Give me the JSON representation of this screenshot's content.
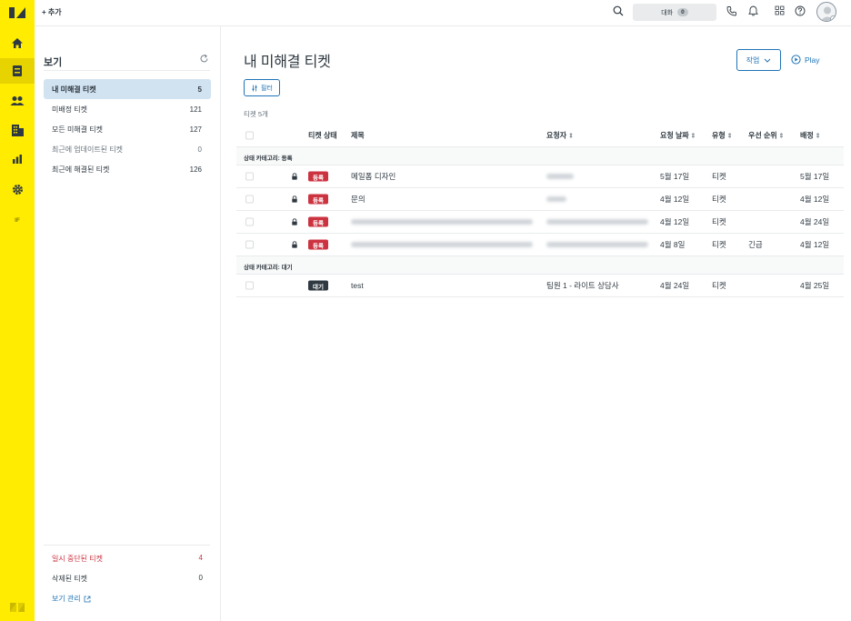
{
  "topbar": {
    "add_label": "+ 추가",
    "chat_label": "대화",
    "chat_count": "0"
  },
  "rail": {
    "items": [
      "home-icon",
      "tickets-icon",
      "users-icon",
      "organizations-icon",
      "reports-icon",
      "settings-icon"
    ],
    "extra_label": "IF"
  },
  "views": {
    "title": "보기",
    "items": [
      {
        "label": "내 미해결 티켓",
        "count": "5"
      },
      {
        "label": "미배정 티켓",
        "count": "121"
      },
      {
        "label": "모든 미해결 티켓",
        "count": "127"
      },
      {
        "label": "최근에 업데이트된 티켓",
        "count": "0"
      },
      {
        "label": "최근에 해결된 티켓",
        "count": "126"
      }
    ],
    "suspended": {
      "label": "일시 중단된 티켓",
      "count": "4"
    },
    "deleted": {
      "label": "삭제된 티켓",
      "count": "0"
    },
    "manage_label": "보기 관리"
  },
  "main": {
    "title": "내 미해결 티켓",
    "action_label": "작업",
    "play_label": "Play",
    "filter_label": "필터",
    "count_label": "티켓 5개",
    "columns": {
      "status": "티켓 상태",
      "subject": "제목",
      "requester": "요청자",
      "requested": "요청 날짜",
      "type": "유형",
      "priority": "우선 순위",
      "assigned": "배정"
    },
    "groups": [
      {
        "label": "상태 카테고리: 등록",
        "rows": [
          {
            "status": "등록",
            "subject": "메일폼 디자인",
            "requested": "5월 17일",
            "type": "티켓",
            "priority": "",
            "assigned": "5월 17일"
          },
          {
            "status": "등록",
            "subject": "문의",
            "requested": "4월 12일",
            "type": "티켓",
            "priority": "",
            "assigned": "4월 12일"
          },
          {
            "status": "등록",
            "subject": "",
            "requested": "4월 12일",
            "type": "티켓",
            "priority": "",
            "assigned": "4월 24일"
          },
          {
            "status": "등록",
            "subject": "",
            "requested": "4월 8일",
            "type": "티켓",
            "priority": "긴급",
            "assigned": "4월 12일"
          }
        ]
      },
      {
        "label": "상태 카테고리: 대기",
        "rows": [
          {
            "status": "대기",
            "subject": "test",
            "requester": "팀원 1 - 라이트 상담사",
            "requested": "4월 24일",
            "type": "티켓",
            "priority": "",
            "assigned": "4월 25일"
          }
        ]
      }
    ]
  },
  "colors": {
    "rail": "#ffec00",
    "accent": "#1f73b7",
    "open_badge": "#cc3340",
    "hold_badge": "#2f3941",
    "selected_view": "#d1e2f1"
  }
}
